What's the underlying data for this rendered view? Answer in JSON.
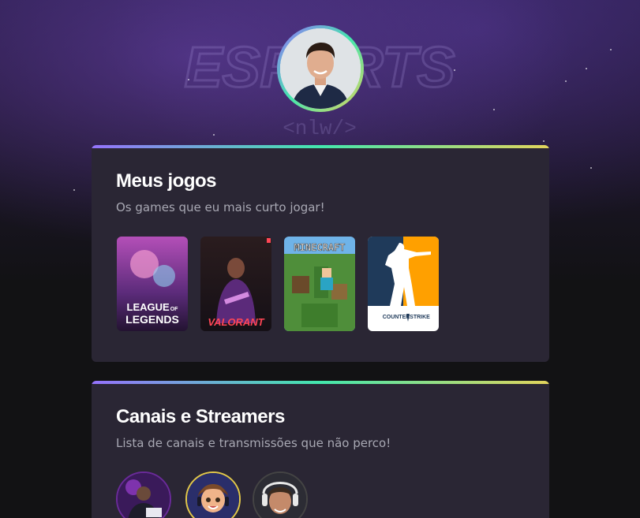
{
  "games_section": {
    "title": "Meus jogos",
    "subtitle": "Os games que eu mais curto jogar!",
    "games": [
      {
        "name": "League of Legends",
        "line1": "LEAGUE",
        "line1_small": "OF",
        "line2": "LEGENDS"
      },
      {
        "name": "Valorant",
        "line1": "VALORANT"
      },
      {
        "name": "Minecraft",
        "line1": "MINECRAFT"
      },
      {
        "name": "Counter Strike",
        "line1": "COUNTER",
        "line1b": "STRIKE"
      }
    ]
  },
  "streamers_section": {
    "title": "Canais e Streamers",
    "subtitle": "Lista de canais e transmissões que não perco!"
  },
  "background": {
    "logo_text": "ESPORTS",
    "logo_tag": "<nlw/>"
  },
  "colors": {
    "gradient_start": "#9572fc",
    "gradient_mid": "#43e7ad",
    "gradient_end": "#e2d45c",
    "card_bg": "#2a2634",
    "page_bg": "#121214"
  }
}
